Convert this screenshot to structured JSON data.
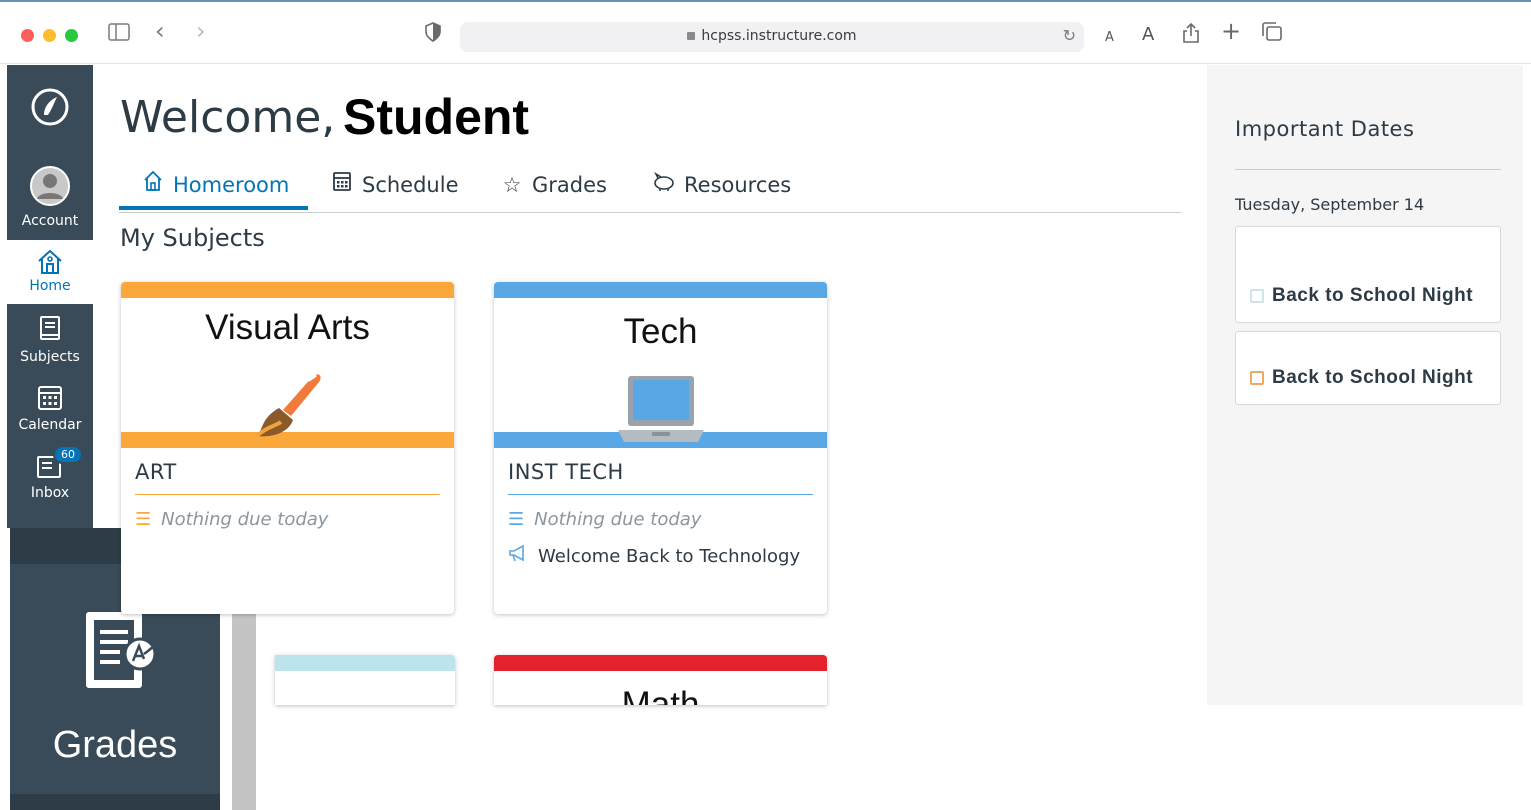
{
  "browser": {
    "url": "hcpss.instructure.com",
    "colors": {
      "close": "#ff5f57",
      "min": "#febc2e",
      "max": "#28c840"
    }
  },
  "nav": {
    "items": [
      {
        "id": "logo",
        "label": ""
      },
      {
        "id": "account",
        "label": "Account"
      },
      {
        "id": "home",
        "label": "Home"
      },
      {
        "id": "subjects",
        "label": "Subjects"
      },
      {
        "id": "calendar",
        "label": "Calendar"
      },
      {
        "id": "inbox",
        "label": "Inbox",
        "badge": "60"
      }
    ],
    "zoom_label": "Grades"
  },
  "header": {
    "welcome": "Welcome,",
    "name": "Student"
  },
  "tabs": [
    {
      "label": "Homeroom",
      "active": true
    },
    {
      "label": "Schedule"
    },
    {
      "label": "Grades"
    },
    {
      "label": "Resources"
    }
  ],
  "subjects_heading": "My Subjects",
  "cards": [
    {
      "title": "Visual Arts",
      "code": "ART",
      "todo": "Nothing due today",
      "color": "#fba83b"
    },
    {
      "title": "Tech",
      "code": "INST TECH",
      "todo": "Nothing due today",
      "announcement": "Welcome Back to Technology",
      "color": "#5aa7e6"
    },
    {
      "title": "",
      "color": "#bde3ec"
    },
    {
      "title": "Math",
      "color": "#e5222c"
    }
  ],
  "sidebar": {
    "title": "Important Dates",
    "date": "Tuesday, September 14",
    "events": [
      {
        "label": "Back to School Night",
        "icon_color": "#cfe3ee"
      },
      {
        "label": "Back to School Night",
        "icon_color": "#f0a760"
      }
    ]
  }
}
